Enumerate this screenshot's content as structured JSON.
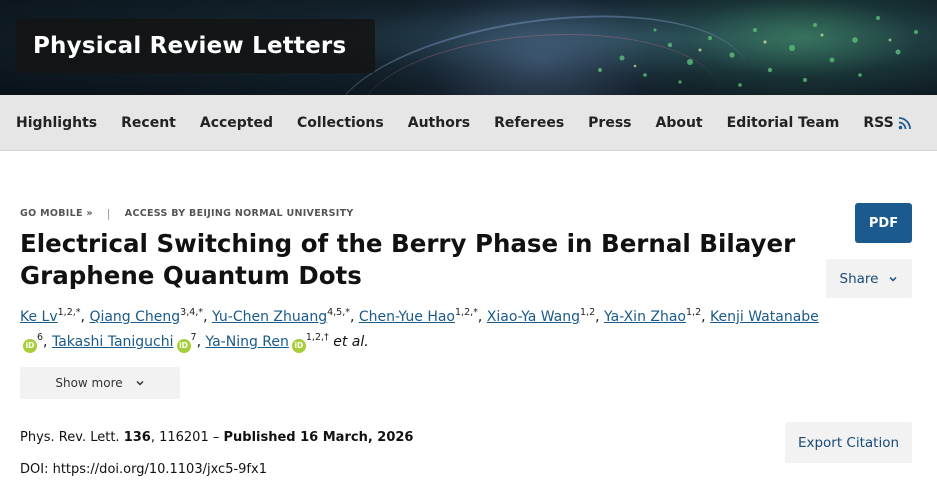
{
  "header": {
    "journal_title": "Physical Review Letters"
  },
  "nav": {
    "items": [
      {
        "label": "Highlights"
      },
      {
        "label": "Recent"
      },
      {
        "label": "Accepted"
      },
      {
        "label": "Collections"
      },
      {
        "label": "Authors"
      },
      {
        "label": "Referees"
      },
      {
        "label": "Press"
      },
      {
        "label": "About"
      },
      {
        "label": "Editorial Team"
      },
      {
        "label": "RSS",
        "icon": "rss-icon"
      }
    ]
  },
  "meta": {
    "go_mobile": "GO MOBILE »",
    "separator": "|",
    "access": "ACCESS BY BEIJING NORMAL UNIVERSITY"
  },
  "article": {
    "title": "Electrical Switching of the Berry Phase in Bernal Bilayer Graphene Quantum Dots",
    "authors": [
      {
        "name": "Ke Lv",
        "sup": "1,2,*",
        "orcid": false
      },
      {
        "name": "Qiang Cheng",
        "sup": "3,4,*",
        "orcid": false
      },
      {
        "name": "Yu-Chen Zhuang",
        "sup": "4,5,*",
        "orcid": false
      },
      {
        "name": "Chen-Yue Hao",
        "sup": "1,2,*",
        "orcid": false
      },
      {
        "name": "Xiao-Ya Wang",
        "sup": "1,2",
        "orcid": false
      },
      {
        "name": "Ya-Xin Zhao",
        "sup": "1,2",
        "orcid": false
      },
      {
        "name": "Kenji Watanabe",
        "sup": "6",
        "orcid": true
      },
      {
        "name": "Takashi Taniguchi",
        "sup": "7",
        "orcid": true
      },
      {
        "name": "Ya-Ning Ren",
        "sup": "1,2,†",
        "orcid": true
      }
    ],
    "et_al": "et al.",
    "orcid_label": "iD",
    "show_more": "Show more",
    "citation": {
      "journal": "Phys. Rev. Lett.",
      "volume": "136",
      "article_number": ", 116201 – ",
      "published": "Published 16 March, 2026"
    },
    "doi": "DOI: https://doi.org/10.1103/jxc5-9fx1"
  },
  "actions": {
    "pdf": "PDF",
    "share": "Share",
    "export_citation": "Export Citation"
  },
  "colors": {
    "primary_blue": "#1a5a8f",
    "link_blue": "#1a5a8a",
    "orcid_green": "#a6ce39",
    "nav_bg": "#e6e6e6"
  }
}
